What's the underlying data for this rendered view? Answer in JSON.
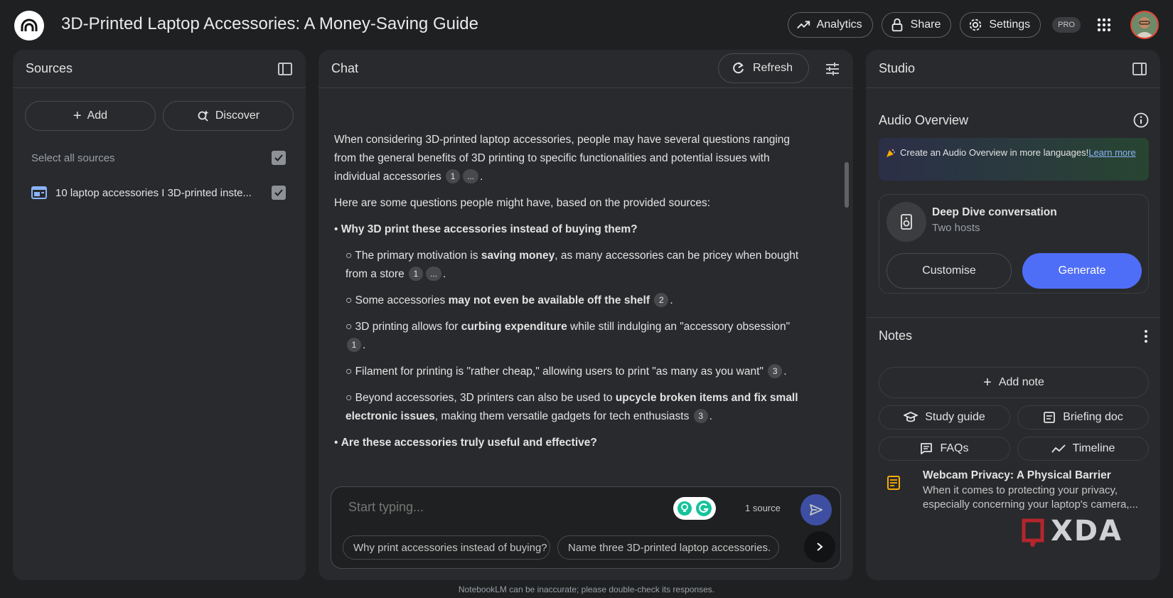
{
  "app": {
    "title": "3D-Printed Laptop Accessories: A Money-Saving Guide",
    "actions": {
      "analytics": "Analytics",
      "share": "Share",
      "settings": "Settings",
      "pro_badge": "PRO"
    }
  },
  "sources": {
    "title": "Sources",
    "add_label": "Add",
    "discover_label": "Discover",
    "select_all_label": "Select all sources",
    "items": [
      {
        "label": "10 laptop accessories I 3D-printed inste...",
        "checked": true
      }
    ]
  },
  "chat": {
    "title": "Chat",
    "refresh_label": "Refresh",
    "message": {
      "p1": "When considering 3D-printed laptop accessories, people may have several questions ranging from the general benefits of 3D printing to specific functionalities and potential issues with individual accessories",
      "p2": "Here are some questions people might have, based on the provided sources:",
      "q1_bullet": "• ",
      "q1": "Why 3D print these accessories instead of buying them?",
      "s1_pre": "○ The primary motivation is ",
      "s1_bold": "saving money",
      "s1_post": ", as many accessories can be pricey when bought from a store",
      "s2_pre": "○ Some accessories ",
      "s2_bold": "may not even be available off the shelf",
      "s3_pre": "○ 3D printing allows for ",
      "s3_bold": "curbing expenditure",
      "s3_post": " while still indulging an \"accessory obsession\"",
      "s4": "○ Filament for printing is \"rather cheap,\" allowing users to print \"as many as you want\"",
      "s5_pre": "○ Beyond accessories, 3D printers can also be used to ",
      "s5_bold": "upcycle broken items and fix small electronic issues",
      "s5_post": ", making them versatile gadgets for tech enthusiasts",
      "q2_bullet": "• ",
      "q2": "Are these accessories truly useful and effective?",
      "cite_1": "1",
      "cite_2": "2",
      "cite_3": "3",
      "cite_more": "...",
      "period": "."
    },
    "composer": {
      "placeholder": "Start typing...",
      "source_count": "1 source",
      "suggestions": [
        "Why print accessories instead of buying?",
        "Name three 3D-printed laptop accessories."
      ]
    }
  },
  "studio": {
    "title": "Studio",
    "audio_overview": {
      "title": "Audio Overview",
      "banner_text": "Create an Audio Overview in more languages!",
      "banner_link": "Learn more",
      "card_title": "Deep Dive conversation",
      "card_subtitle": "Two hosts",
      "customise_label": "Customise",
      "generate_label": "Generate"
    },
    "notes": {
      "title": "Notes",
      "add_note_label": "Add note",
      "chips": [
        "Study guide",
        "Briefing doc",
        "FAQs",
        "Timeline"
      ],
      "items": [
        {
          "title": "Webcam Privacy: A Physical Barrier",
          "snippet": "When it comes to protecting your privacy, especially concerning your laptop's camera,..."
        }
      ]
    }
  },
  "watermark": "XDA",
  "footer": "NotebookLM can be inaccurate; please double-check its responses.",
  "colors": {
    "accent": "#4f6ef7",
    "background": "#1f2021",
    "panel": "#292a2d"
  }
}
